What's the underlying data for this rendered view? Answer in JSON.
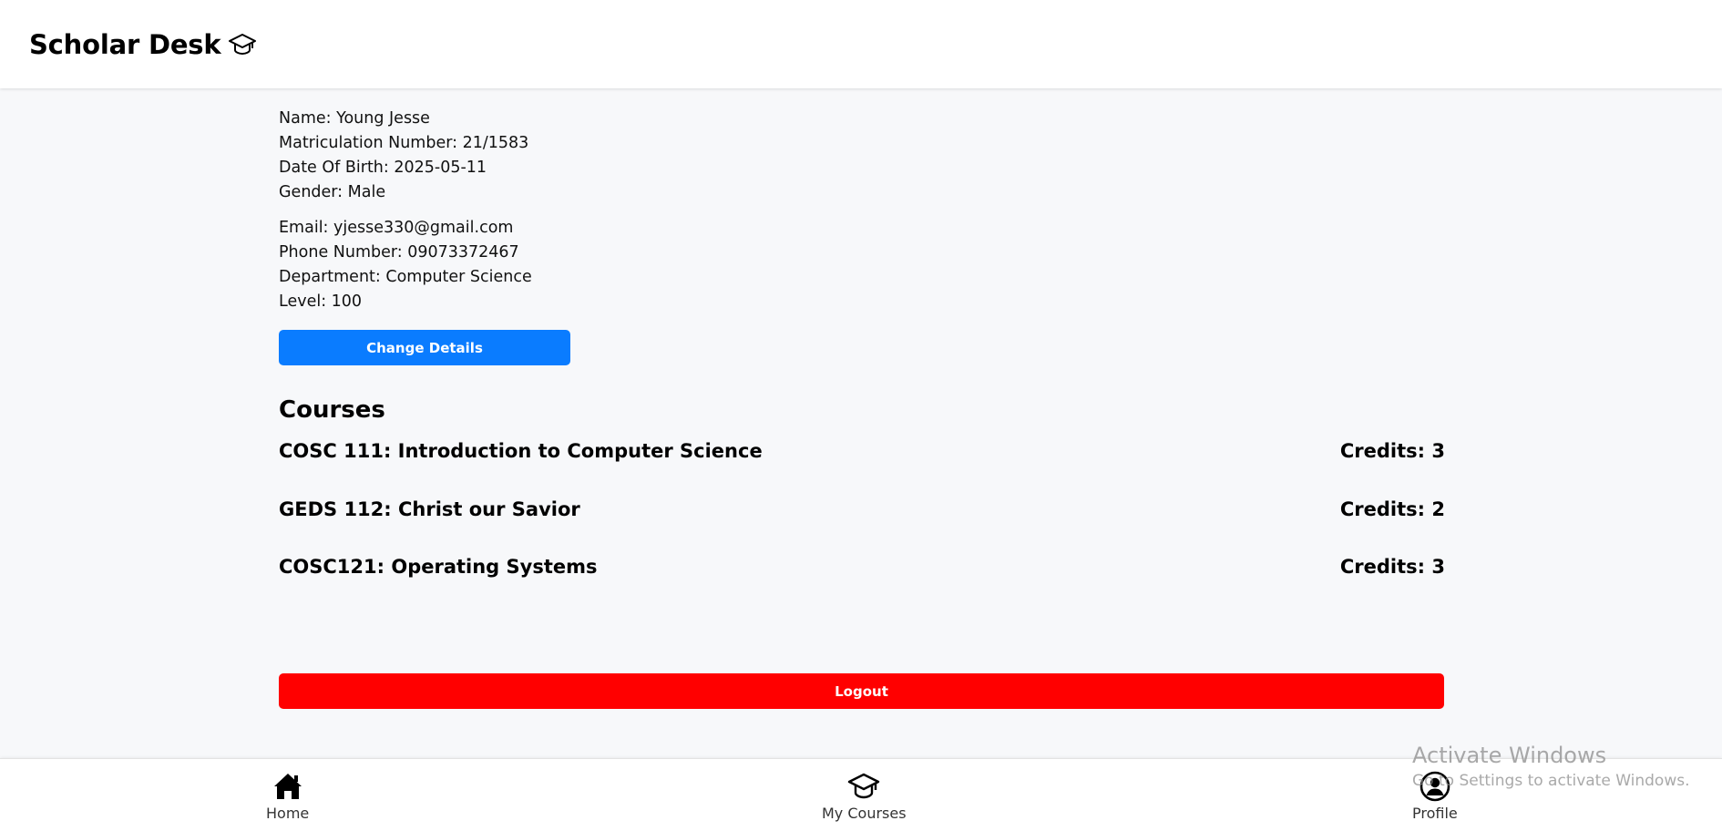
{
  "header": {
    "brand": "Scholar Desk",
    "brand_icon": "graduation-cap-icon"
  },
  "profile": {
    "personal": [
      "Name: Young Jesse",
      "Matriculation Number: 21/1583",
      "Date Of Birth: 2025-05-11",
      "Gender: Male"
    ],
    "contact": [
      "Email: yjesse330@gmail.com",
      "Phone Number: 09073372467",
      "Department: Computer Science",
      "Level: 100"
    ],
    "change_button": "Change Details"
  },
  "courses": {
    "title": "Courses",
    "items": [
      {
        "name": "COSC 111: Introduction to Computer Science",
        "credits": "Credits: 3"
      },
      {
        "name": "GEDS 112: Christ our Savior",
        "credits": "Credits: 2"
      },
      {
        "name": "COSC121: Operating Systems",
        "credits": "Credits: 3"
      }
    ]
  },
  "logout_button": "Logout",
  "bottom_nav": [
    {
      "label": "Home",
      "icon": "home-icon"
    },
    {
      "label": "My Courses",
      "icon": "graduation-cap-icon"
    },
    {
      "label": "Profile",
      "icon": "user-circle-icon"
    }
  ],
  "watermark": {
    "title": "Activate Windows",
    "subtitle": "Go to Settings to activate Windows."
  },
  "colors": {
    "primary_button": "#0a7cff",
    "logout_button": "#ff0000",
    "page_background": "#f7f8fa"
  }
}
